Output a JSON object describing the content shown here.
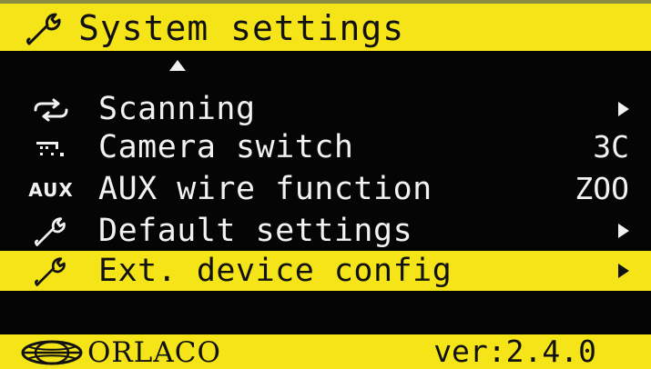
{
  "header": {
    "icon": "wrench-icon",
    "title": "System settings"
  },
  "menu": {
    "items": [
      {
        "icon": "swap-arrows-icon",
        "label": "Scanning",
        "value": "",
        "has_submenu": true,
        "selected": false
      },
      {
        "icon": "camera-switch-icon",
        "label": "Camera switch",
        "value": "3C",
        "has_submenu": false,
        "selected": false
      },
      {
        "icon_text": "AUX",
        "label": "AUX wire function",
        "value": "ZOO",
        "has_submenu": false,
        "selected": false
      },
      {
        "icon": "wrench-icon",
        "label": "Default settings",
        "value": "",
        "has_submenu": true,
        "selected": false
      },
      {
        "icon": "wrench-icon",
        "label": "Ext. device config",
        "value": "",
        "has_submenu": true,
        "selected": true
      }
    ]
  },
  "footer": {
    "logo": "orlaco-logo",
    "brand": "ORLACO",
    "version": "ver:2.4.0"
  },
  "colors": {
    "highlight": "#f4e418",
    "background": "#050505",
    "text": "#f2f2f2",
    "text_on_highlight": "#111111"
  }
}
